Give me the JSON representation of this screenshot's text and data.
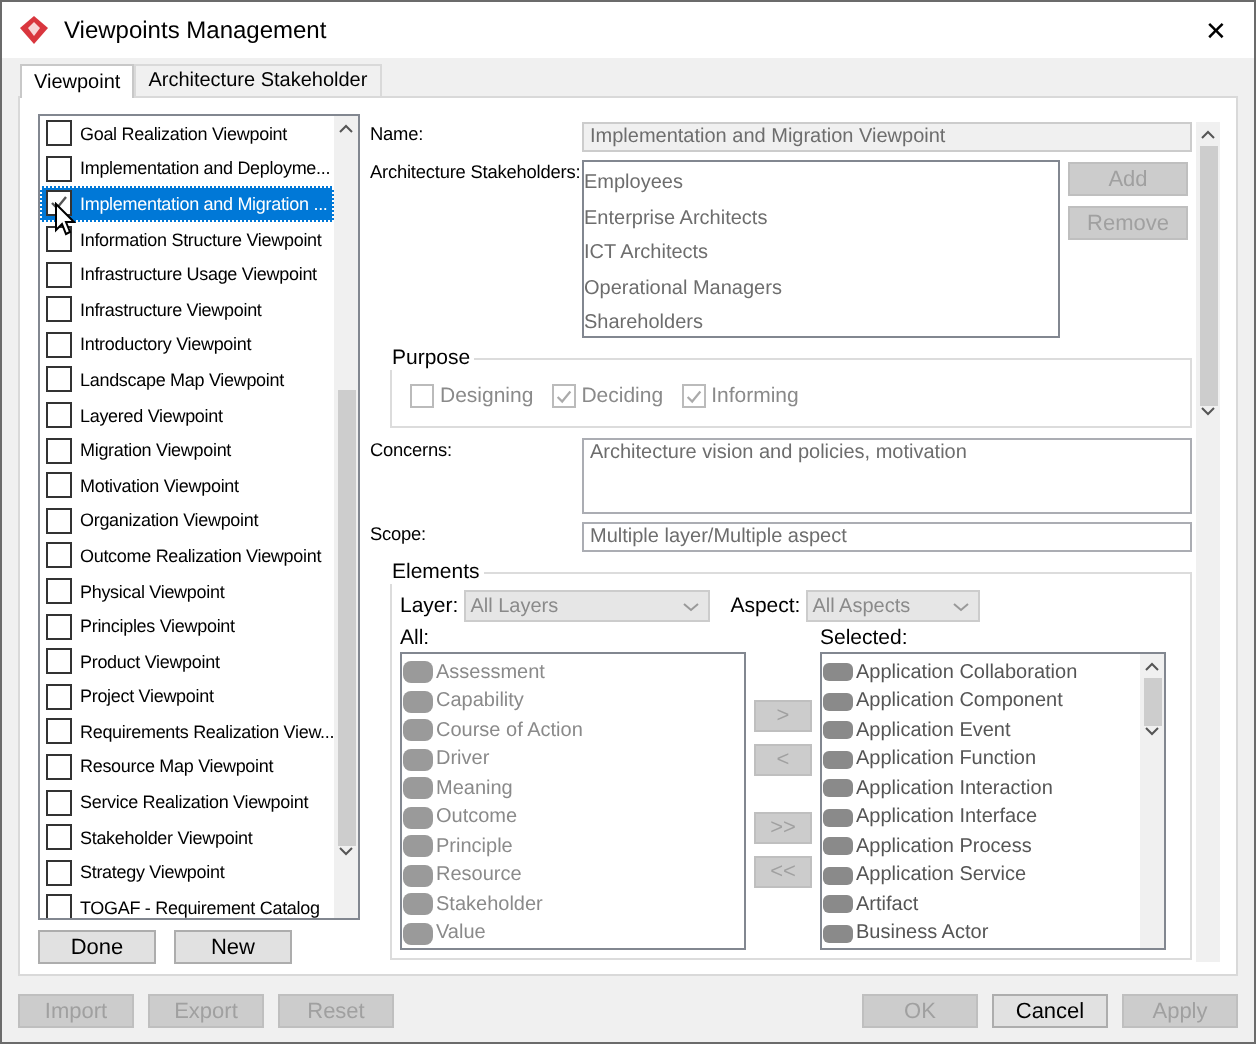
{
  "window": {
    "title": "Viewpoints Management",
    "close": "✕"
  },
  "tabs": [
    {
      "label": "Viewpoint",
      "selected": true
    },
    {
      "label": "Architecture Stakeholder",
      "selected": false
    }
  ],
  "viewpoints": [
    {
      "label": "Goal Realization Viewpoint",
      "checked": false,
      "selected": false
    },
    {
      "label": "Implementation and Deployme...",
      "checked": false,
      "selected": false
    },
    {
      "label": "Implementation and Migration ...",
      "checked": true,
      "selected": true
    },
    {
      "label": "Information Structure Viewpoint",
      "checked": false,
      "selected": false
    },
    {
      "label": "Infrastructure Usage Viewpoint",
      "checked": false,
      "selected": false
    },
    {
      "label": "Infrastructure Viewpoint",
      "checked": false,
      "selected": false
    },
    {
      "label": "Introductory Viewpoint",
      "checked": false,
      "selected": false
    },
    {
      "label": "Landscape Map Viewpoint",
      "checked": false,
      "selected": false
    },
    {
      "label": "Layered Viewpoint",
      "checked": false,
      "selected": false
    },
    {
      "label": "Migration Viewpoint",
      "checked": false,
      "selected": false
    },
    {
      "label": "Motivation Viewpoint",
      "checked": false,
      "selected": false
    },
    {
      "label": "Organization Viewpoint",
      "checked": false,
      "selected": false
    },
    {
      "label": "Outcome Realization Viewpoint",
      "checked": false,
      "selected": false
    },
    {
      "label": "Physical Viewpoint",
      "checked": false,
      "selected": false
    },
    {
      "label": "Principles Viewpoint",
      "checked": false,
      "selected": false
    },
    {
      "label": "Product Viewpoint",
      "checked": false,
      "selected": false
    },
    {
      "label": "Project Viewpoint",
      "checked": false,
      "selected": false
    },
    {
      "label": "Requirements Realization View...",
      "checked": false,
      "selected": false
    },
    {
      "label": "Resource Map Viewpoint",
      "checked": false,
      "selected": false
    },
    {
      "label": "Service Realization Viewpoint",
      "checked": false,
      "selected": false
    },
    {
      "label": "Stakeholder Viewpoint",
      "checked": false,
      "selected": false
    },
    {
      "label": "Strategy Viewpoint",
      "checked": false,
      "selected": false
    },
    {
      "label": "TOGAF - Requirement Catalog",
      "checked": false,
      "selected": false
    }
  ],
  "list_buttons": [
    {
      "label": "Done",
      "disabled": false
    },
    {
      "label": "New",
      "disabled": false
    }
  ],
  "name": {
    "label": "Name:",
    "value": "Implementation and Migration Viewpoint",
    "disabled": true
  },
  "stakeholders": {
    "label": "Architecture Stakeholders:",
    "items": [
      "Employees",
      "Enterprise Architects",
      "ICT Architects",
      "Operational Managers",
      "Shareholders"
    ],
    "buttons": [
      {
        "label": "Add",
        "disabled": true
      },
      {
        "label": "Remove",
        "disabled": true
      }
    ]
  },
  "purpose": {
    "title": "Purpose",
    "disabled": true,
    "options": [
      {
        "label": "Designing",
        "checked": false
      },
      {
        "label": "Deciding",
        "checked": true
      },
      {
        "label": "Informing",
        "checked": true
      }
    ]
  },
  "concerns": {
    "label": "Concerns:",
    "value": "Architecture vision and policies, motivation"
  },
  "scope": {
    "label": "Scope:",
    "value": "Multiple layer/Multiple aspect"
  },
  "elements": {
    "title": "Elements",
    "layer": {
      "label": "Layer:",
      "value": "All Layers",
      "disabled": true
    },
    "aspect": {
      "label": "Aspect:",
      "value": "All Aspects",
      "disabled": true
    },
    "all": {
      "label": "All:",
      "disabled": true,
      "items": [
        "Assessment",
        "Capability",
        "Course of Action",
        "Driver",
        "Meaning",
        "Outcome",
        "Principle",
        "Resource",
        "Stakeholder",
        "Value"
      ]
    },
    "transfer_buttons": [
      {
        "label": ">",
        "disabled": true
      },
      {
        "label": "<",
        "disabled": true
      },
      {
        "label": ">>",
        "disabled": true
      },
      {
        "label": "<<",
        "disabled": true
      }
    ],
    "selected": {
      "label": "Selected:",
      "items": [
        "Application Collaboration",
        "Application Component",
        "Application Event",
        "Application Function",
        "Application Interaction",
        "Application Interface",
        "Application Process",
        "Application Service",
        "Artifact",
        "Business Actor"
      ]
    }
  },
  "footer_left": [
    {
      "label": "Import",
      "disabled": true
    },
    {
      "label": "Export",
      "disabled": true
    },
    {
      "label": "Reset",
      "disabled": true
    }
  ],
  "footer_right": [
    {
      "label": "OK",
      "disabled": true
    },
    {
      "label": "Cancel",
      "disabled": false
    },
    {
      "label": "Apply",
      "disabled": true
    }
  ]
}
